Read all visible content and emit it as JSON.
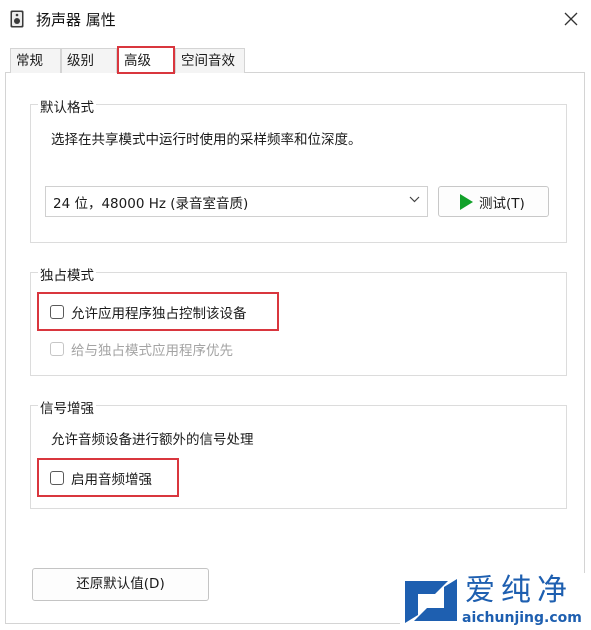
{
  "window": {
    "title": "扬声器 属性"
  },
  "tabs": [
    {
      "label": "常规"
    },
    {
      "label": "级别"
    },
    {
      "label": "高级"
    },
    {
      "label": "空间音效"
    }
  ],
  "default_format": {
    "title": "默认格式",
    "description": "选择在共享模式中运行时使用的采样频率和位深度。",
    "selected": "24 位，48000 Hz (录音室音质)",
    "test_label": "测试(T)"
  },
  "exclusive_mode": {
    "title": "独占模式",
    "allow_exclusive": {
      "label": "允许应用程序独占控制该设备",
      "checked": false
    },
    "give_priority": {
      "label": "给与独占模式应用程序优先",
      "checked": false,
      "disabled": true
    }
  },
  "signal_enhancement": {
    "title": "信号增强",
    "description": "允许音频设备进行额外的信号处理",
    "enable_enhancement": {
      "label": "启用音频增强",
      "checked": false
    }
  },
  "restore_defaults_label": "还原默认值(D)",
  "watermark": {
    "text": "爱纯净",
    "url": "aichunjing.com"
  },
  "colors": {
    "highlight": "#d9363e",
    "play_green": "#12a12a",
    "watermark_blue": "#1e5fb0"
  }
}
